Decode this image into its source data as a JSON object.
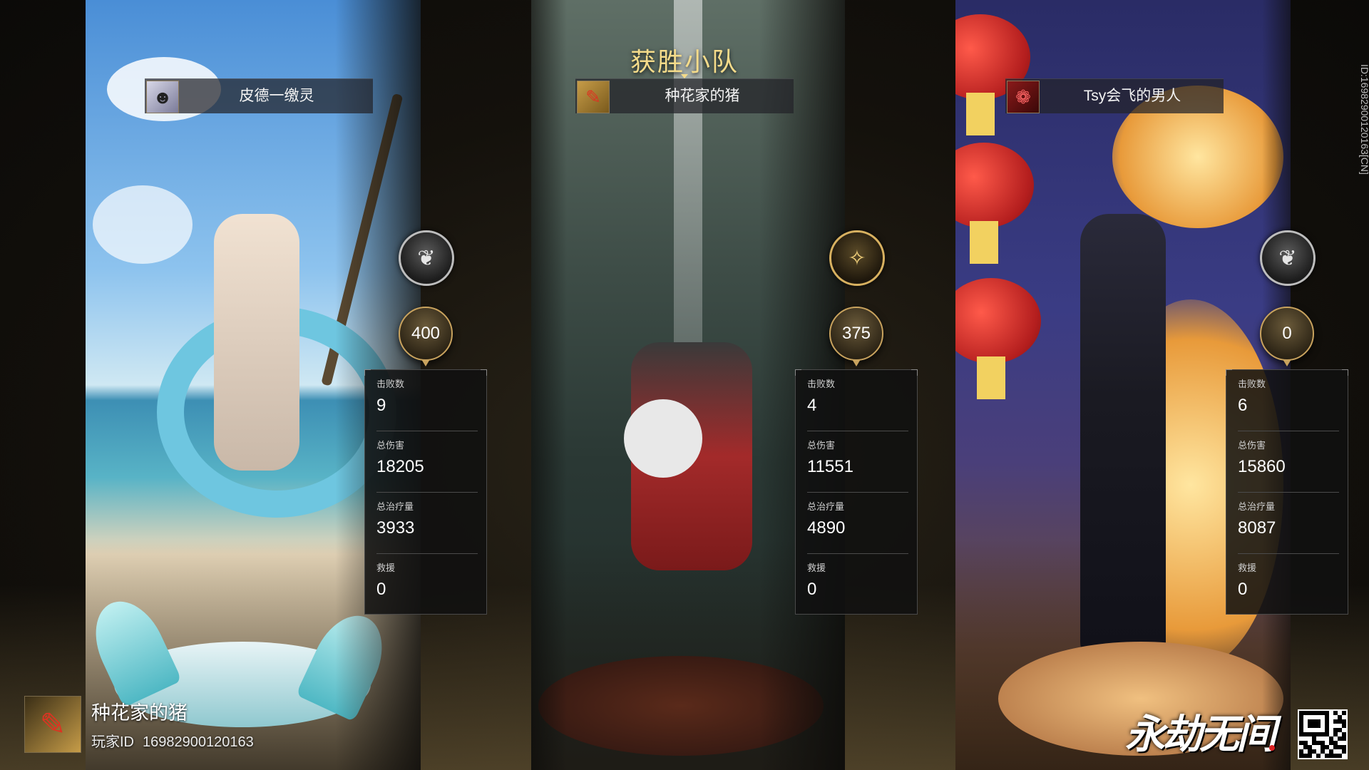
{
  "header": {
    "title": "获胜小队"
  },
  "players": [
    {
      "name": "皮德一缴灵",
      "avatar_icon": "portrait-icon",
      "rank_icon": "silver-rank-icon",
      "score": "400",
      "stats": [
        {
          "label": "击败数",
          "value": "9"
        },
        {
          "label": "总伤害",
          "value": "18205"
        },
        {
          "label": "总治疗量",
          "value": "3933"
        },
        {
          "label": "救援",
          "value": "0"
        }
      ]
    },
    {
      "name": "种花家的猪",
      "avatar_icon": "mvp-emblem-icon",
      "rank_icon": "gold-rank-icon",
      "score": "375",
      "stats": [
        {
          "label": "击败数",
          "value": "4"
        },
        {
          "label": "总伤害",
          "value": "11551"
        },
        {
          "label": "总治疗量",
          "value": "4890"
        },
        {
          "label": "救援",
          "value": "0"
        }
      ]
    },
    {
      "name": "Tsy会飞的男人",
      "avatar_icon": "red-crest-icon",
      "rank_icon": "silver-rank-icon",
      "score": "0",
      "stats": [
        {
          "label": "击败数",
          "value": "6"
        },
        {
          "label": "总伤害",
          "value": "15860"
        },
        {
          "label": "总治疗量",
          "value": "8087"
        },
        {
          "label": "救援",
          "value": "0"
        }
      ]
    }
  ],
  "footer": {
    "player_name": "种花家的猪",
    "player_id_label": "玩家ID",
    "player_id_value": "16982900120163",
    "logo_text": "永劫无间",
    "vertical_id": "ID:16982900120163[CN]"
  },
  "colors": {
    "accent_gold": "#f4db8a",
    "panel_bg": "#101010"
  }
}
